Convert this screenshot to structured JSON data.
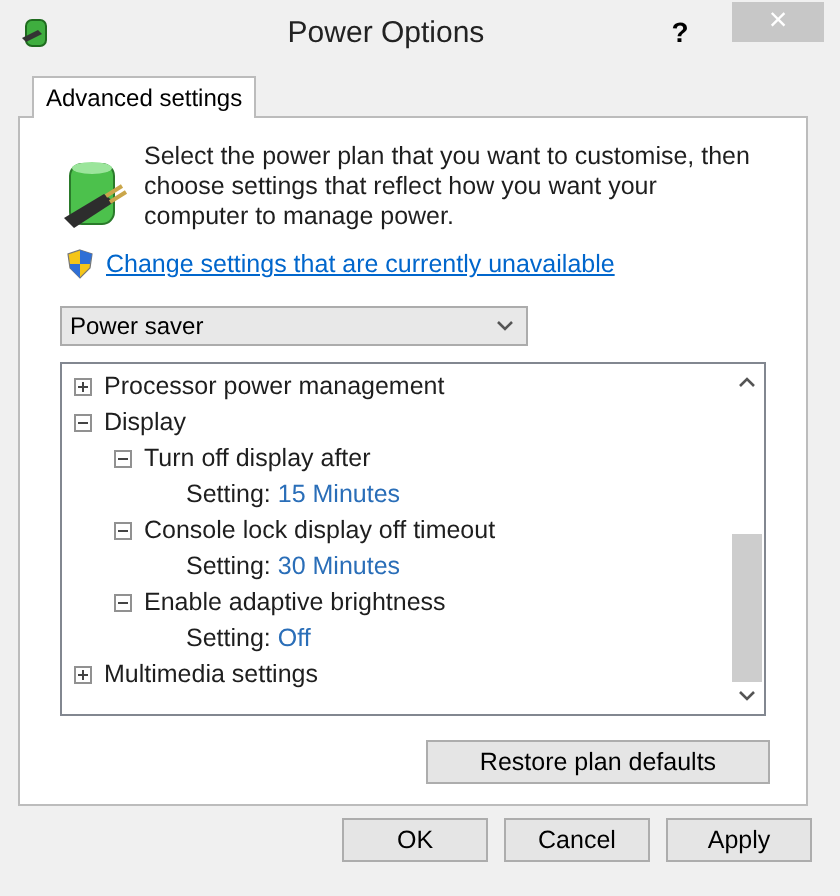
{
  "window": {
    "title": "Power Options",
    "help": "?",
    "close": "×"
  },
  "tabs": [
    {
      "label": "Advanced settings",
      "selected": true
    }
  ],
  "intro": "Select the power plan that you want to customise, then choose settings that reflect how you want your computer to manage power.",
  "change_link": "Change settings that are currently unavailable",
  "plan_dropdown": {
    "value": "Power saver"
  },
  "tree": [
    {
      "label": "Processor power management",
      "expanded": false
    },
    {
      "label": "Display",
      "expanded": true,
      "children": [
        {
          "label": "Turn off display after",
          "expanded": true,
          "children": [
            {
              "kind": "setting",
              "label": "Setting:",
              "value": "15 Minutes"
            }
          ]
        },
        {
          "label": "Console lock display off timeout",
          "expanded": true,
          "children": [
            {
              "kind": "setting",
              "label": "Setting:",
              "value": "30 Minutes"
            }
          ]
        },
        {
          "label": "Enable adaptive brightness",
          "expanded": true,
          "children": [
            {
              "kind": "setting",
              "label": "Setting:",
              "value": "Off"
            }
          ]
        }
      ]
    },
    {
      "label": "Multimedia settings",
      "expanded": false
    }
  ],
  "restore_button": "Restore plan defaults",
  "buttons": [
    "OK",
    "Cancel",
    "Apply"
  ]
}
